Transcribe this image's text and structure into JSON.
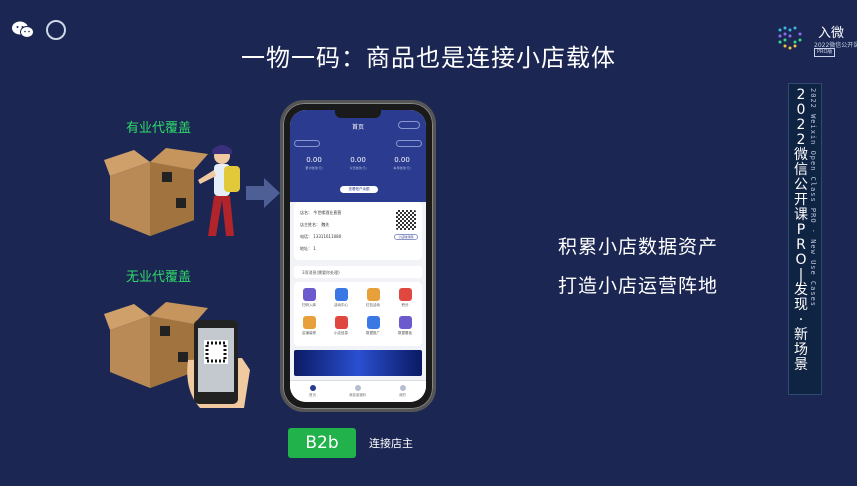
{
  "title": "一物一码：商品也是连接小店载体",
  "brand": {
    "name": "入微",
    "sub": "2022微信公开课",
    "pro": "PRO版"
  },
  "labels": {
    "covered": "有业代覆盖",
    "uncovered": "无业代覆盖"
  },
  "right_text": [
    "积累小店数据资产",
    "打造小店运营阵地"
  ],
  "badge": {
    "label": "B2b",
    "caption": "连接店主"
  },
  "side_banner": {
    "english": "2022 Weixin Open Class PRO · New Use Cases",
    "chinese_chars": [
      "2",
      "0",
      "2",
      "2",
      "微",
      "信",
      "公",
      "开",
      "课",
      "P",
      "R",
      "O",
      "|",
      "发",
      "现",
      "·",
      "新",
      "场",
      "景"
    ]
  },
  "phone": {
    "app_title": "首页",
    "stats": [
      {
        "value": "0.00",
        "label": "累计收款(元)"
      },
      {
        "value": "0.00",
        "label": "今日收款(元)"
      },
      {
        "value": "0.00",
        "label": "本月收款(元)"
      }
    ],
    "pill_label": "查看账户余额",
    "info_rows": [
      "店名：    今世缘酒业直营",
      "店主姓名：    魏先",
      "电话：    13311611080",
      "地址：    1"
    ],
    "qr_button": "小店收款码",
    "notice": "3项消息(需要你处理)",
    "grid_items": [
      "扫码入库",
      "活动中心",
      "红包活动",
      "积分",
      "店铺装修",
      "小店信息",
      "数据推广",
      "数据看板"
    ],
    "tabs": [
      "首页",
      "消费者福利",
      "我的"
    ],
    "colors": {
      "header": "#2b3b8f",
      "icon_purple": "#6a5acd",
      "icon_blue": "#3a78e6",
      "icon_gold": "#e8a13a",
      "icon_red": "#e0473e"
    }
  }
}
